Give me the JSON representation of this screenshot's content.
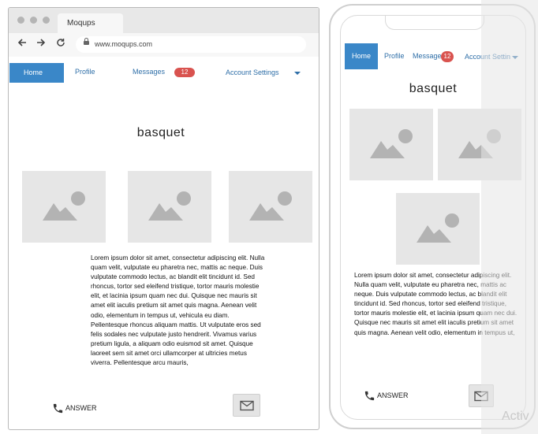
{
  "browser": {
    "tab_title": "Moqups",
    "url": "www.moqups.com"
  },
  "nav": {
    "home": "Home",
    "profile": "Profile",
    "messages": "Messages",
    "messages_badge": "12",
    "account_settings": "Account Settings"
  },
  "phone_nav": {
    "home": "Home",
    "profile": "Profile",
    "messages": "Message",
    "messages_badge": "12",
    "account_settings": "Account Settin"
  },
  "page": {
    "heading": "basquet",
    "paragraph": "Lorem ipsum dolor sit amet, consectetur adipiscing elit. Nulla quam velit, vulputate eu pharetra nec, mattis ac neque. Duis vulputate commodo lectus, ac blandit elit tincidunt id. Sed rhoncus, tortor sed eleifend tristique, tortor mauris molestie elit, et lacinia ipsum quam nec dui. Quisque nec mauris sit amet elit iaculis pretium sit amet quis magna. Aenean velit odio, elementum in tempus ut, vehicula eu diam. Pellentesque rhoncus aliquam mattis. Ut vulputate eros sed felis sodales nec vulputate justo hendrerit. Vivamus varius pretium ligula, a aliquam odio euismod sit amet. Quisque laoreet sem sit amet orci ullamcorper at ultricies metus viverra. Pellentesque arcu mauris,",
    "phone_paragraph": "Lorem ipsum dolor sit amet, consectetur adipiscing elit. Nulla quam velit, vulputate eu pharetra nec, mattis ac neque. Duis vulputate commodo lectus, ac blandit elit tincidunt id. Sed rhoncus, tortor sed eleifend tristique, tortor mauris molestie elit, et lacinia ipsum quam nec dui. Quisque nec mauris sit amet elit iaculis pretium sit amet quis magna. Aenean velit odio, elementum in tempus ut,",
    "answer": "ANSWER"
  },
  "overlay": {
    "watermark": "Activ"
  },
  "colors": {
    "accent": "#3a87c8",
    "badge": "#d9534f",
    "placeholder_bg": "#e6e6e6",
    "placeholder_fg": "#b3b3b3"
  },
  "icons": {
    "back": "arrow-left-icon",
    "forward": "arrow-right-icon",
    "reload": "reload-icon",
    "lock": "lock-icon",
    "phone": "phone-icon",
    "mail": "mail-icon",
    "image": "image-placeholder-icon",
    "dropdown": "chevron-down-icon"
  }
}
